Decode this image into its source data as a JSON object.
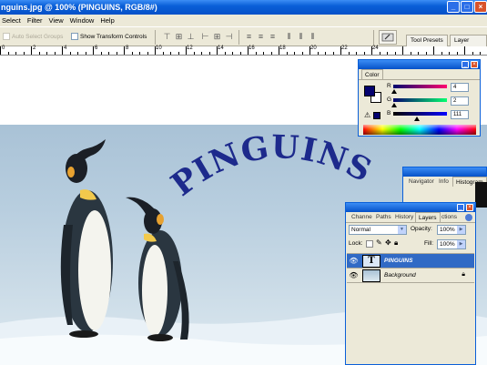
{
  "window": {
    "title": "nguins.jpg @ 100% (PINGUINS, RGB/8#)"
  },
  "menu": {
    "items": [
      "Select",
      "Filter",
      "View",
      "Window",
      "Help"
    ]
  },
  "options": {
    "auto_select_groups": "Auto Select Groups",
    "show_transform_controls": "Show Transform Controls",
    "tool_presets_tab": "Tool Presets",
    "layer_comps_tab": "Layer Comps"
  },
  "ruler": {
    "labels": [
      "0",
      "2",
      "4",
      "6",
      "8",
      "10",
      "12",
      "14",
      "16",
      "18",
      "20",
      "22",
      "24"
    ]
  },
  "canvas": {
    "text_layer": "PINGUINS",
    "text_color": "#1d2a8c"
  },
  "color_panel": {
    "tab": "Color",
    "channels": [
      {
        "label": "R",
        "value": "4",
        "fraction": 0.02
      },
      {
        "label": "G",
        "value": "2",
        "fraction": 0.01
      },
      {
        "label": "B",
        "value": "111",
        "fraction": 0.44
      }
    ],
    "foreground": "#04026f",
    "background": "#ffffff"
  },
  "navigator_panel": {
    "tabs": [
      "Navigator",
      "Info",
      "Histogram"
    ]
  },
  "layers_panel": {
    "tabs": [
      "Channe",
      "Paths",
      "History",
      "Layers",
      "ctions"
    ],
    "blend_mode": "Normal",
    "opacity_label": "Opacity:",
    "opacity_value": "100%",
    "lock_label": "Lock:",
    "fill_label": "Fill:",
    "fill_value": "100%",
    "layers": [
      {
        "name": "PINGUINS",
        "type": "text",
        "selected": true
      },
      {
        "name": "Background",
        "type": "image",
        "selected": false
      }
    ]
  }
}
